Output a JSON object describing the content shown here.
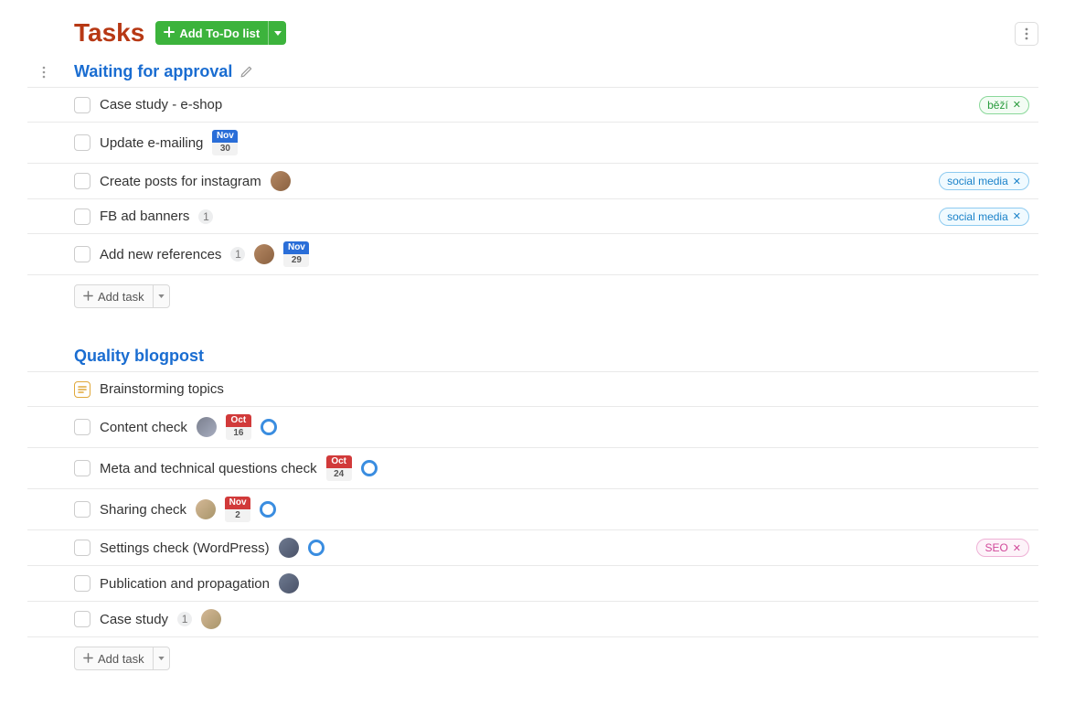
{
  "header": {
    "title": "Tasks",
    "add_list_label": "Add To-Do list"
  },
  "add_task_label": "Add task",
  "lists": [
    {
      "title": "Waiting for approval",
      "editable": true,
      "handle": true,
      "tasks": [
        {
          "title": "Case study - e-shop",
          "tags": [
            {
              "label": "běží",
              "style": "green"
            }
          ]
        },
        {
          "title": "Update e-mailing",
          "date": {
            "month": "Nov",
            "day": "30",
            "style": "blue"
          }
        },
        {
          "title": "Create posts for instagram",
          "avatar": "a1",
          "tags": [
            {
              "label": "social media",
              "style": "blue"
            }
          ]
        },
        {
          "title": "FB ad banners",
          "count": "1",
          "tags": [
            {
              "label": "social media",
              "style": "blue"
            }
          ]
        },
        {
          "title": "Add new references",
          "count": "1",
          "avatar": "a1",
          "date": {
            "month": "Nov",
            "day": "29",
            "style": "blue"
          }
        }
      ]
    },
    {
      "title": "Quality blogpost",
      "tasks": [
        {
          "title": "Brainstorming topics",
          "note": true
        },
        {
          "title": "Content check",
          "avatar": "a2",
          "date": {
            "month": "Oct",
            "day": "16",
            "style": "red"
          },
          "reminder": true
        },
        {
          "title": "Meta and technical questions check",
          "date": {
            "month": "Oct",
            "day": "24",
            "style": "red"
          },
          "reminder": true
        },
        {
          "title": "Sharing check",
          "avatar": "a3",
          "date": {
            "month": "Nov",
            "day": "2",
            "style": "red"
          },
          "reminder": true
        },
        {
          "title": "Settings check (WordPress)",
          "avatar": "a4",
          "reminder": true,
          "tags": [
            {
              "label": "SEO",
              "style": "pink"
            }
          ]
        },
        {
          "title": "Publication and propagation",
          "avatar": "a4"
        },
        {
          "title": "Case study",
          "count": "1",
          "avatar": "a3"
        }
      ]
    }
  ]
}
